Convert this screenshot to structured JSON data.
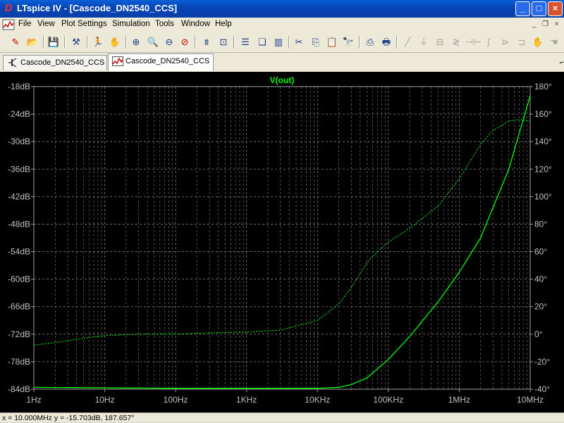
{
  "window": {
    "title": "LTspice IV - [Cascode_DN2540_CCS]"
  },
  "menu": [
    "File",
    "View",
    "Plot Settings",
    "Simulation",
    "Tools",
    "Window",
    "Help"
  ],
  "tabs": [
    {
      "label": "Cascode_DN2540_CCS",
      "kind": "schematic-icon",
      "active": false
    },
    {
      "label": "Cascode_DN2540_CCS",
      "kind": "waveform-icon",
      "active": true
    }
  ],
  "status": {
    "text": "x = 10.000MHz    y = -15.703dB, 187.657°"
  },
  "chart_data": {
    "type": "line",
    "title": "V(out)",
    "x_scale": "log",
    "x_ticks": [
      "1Hz",
      "10Hz",
      "100Hz",
      "1KHz",
      "10KHz",
      "100KHz",
      "1MHz",
      "10MHz"
    ],
    "y_left_ticks": [
      "-18dB",
      "-24dB",
      "-30dB",
      "-36dB",
      "-42dB",
      "-48dB",
      "-54dB",
      "-60dB",
      "-66dB",
      "-72dB",
      "-78dB",
      "-84dB"
    ],
    "y_right_ticks": [
      "180°",
      "160°",
      "140°",
      "120°",
      "100°",
      "80°",
      "60°",
      "40°",
      "20°",
      "0°",
      "-20°",
      "-40°"
    ],
    "xlim_hz": [
      1,
      10000000
    ],
    "ylim_left_db": [
      -84,
      -18
    ],
    "ylim_right_deg": [
      -40,
      180
    ],
    "grid": true,
    "colors": {
      "background": "#000000",
      "trace": "#00ff00",
      "axis": "#a0a0a0",
      "grid": "#808080",
      "labels": "#c0c0c0",
      "title": "#00ff00"
    },
    "series": [
      {
        "name": "magnitude",
        "style": "solid",
        "axis": "left",
        "x_hz": [
          1,
          100,
          1000,
          10000,
          20000,
          30000,
          50000,
          100000,
          200000,
          500000,
          1000000,
          2000000,
          5000000,
          10000000
        ],
        "y": [
          -83.6,
          -83.8,
          -83.8,
          -83.8,
          -83.6,
          -83.0,
          -81.5,
          -77.5,
          -72.5,
          -65.0,
          -58.5,
          -51.0,
          -36.0,
          -20.0
        ]
      },
      {
        "name": "phase",
        "style": "dashed",
        "axis": "right",
        "x_hz": [
          1,
          2,
          5,
          10,
          30,
          100,
          300,
          1000,
          3000,
          10000,
          20000,
          30000,
          50000,
          70000,
          100000,
          200000,
          500000,
          1000000,
          2000000,
          3000000,
          5000000,
          7000000,
          10000000
        ],
        "y": [
          -8,
          -6,
          -3,
          -1,
          0,
          0,
          1,
          1.5,
          3,
          10,
          22,
          34,
          52,
          60,
          67,
          77,
          93,
          113,
          138,
          148,
          155,
          156,
          155
        ]
      }
    ]
  }
}
